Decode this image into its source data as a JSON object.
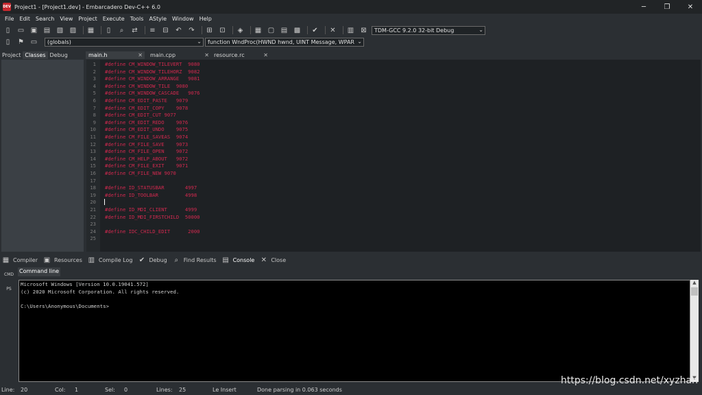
{
  "window": {
    "logo_text": "DEV",
    "title": "Project1 - [Project1.dev] - Embarcadero Dev-C++ 6.0",
    "minimize": "─",
    "restore": "❐",
    "close": "✕"
  },
  "menu": [
    "File",
    "Edit",
    "Search",
    "View",
    "Project",
    "Execute",
    "Tools",
    "AStyle",
    "Window",
    "Help"
  ],
  "toolbar": {
    "compiler_select": "TDM-GCC 9.2.0 32-bit Debug",
    "scope_select": "(globals)",
    "function_select": "function WndProc(HWND hwnd, UINT Message, WPAR"
  },
  "left_tabs": [
    "Project",
    "Classes",
    "Debug"
  ],
  "left_active": "Classes",
  "editor_tabs": [
    {
      "label": "main.h",
      "active": true
    },
    {
      "label": "main.cpp",
      "active": false
    },
    {
      "label": "resource.rc",
      "active": false
    }
  ],
  "code_lines": [
    "#define CM_WINDOW_TILEVERT  9080",
    "#define CM_WINDOW_TILEHORZ  9082",
    "#define CM_WINDOW_ARRANGE   9081",
    "#define CM_WINDOW_TILE  9080",
    "#define CM_WINDOW_CASCADE   9076",
    "#define CM_EDIT_PASTE   9079",
    "#define CM_EDIT_COPY    9078",
    "#define CM_EDIT_CUT 9077",
    "#define CM_EDIT_REDO    9076",
    "#define CM_EDIT_UNDO    9075",
    "#define CM_FILE_SAVEAS  9074",
    "#define CM_FILE_SAVE    9073",
    "#define CM_FILE_OPEN    9072",
    "#define CM_HELP_ABOUT   9072",
    "#define CM_FILE_EXIT    9071",
    "#define CM_FILE_NEW 9070",
    "",
    "#define ID_STATUSBAR       4997",
    "#define ID_TOOLBAR         4998",
    "",
    "#define ID_MDI_CLIENT      4999",
    "#define ID_MDI_FIRSTCHILD  50000",
    "",
    "#define IDC_CHILD_EDIT      2000",
    ""
  ],
  "bottom_tabs": [
    {
      "label": "Compiler",
      "icon": "grid-icon"
    },
    {
      "label": "Resources",
      "icon": "resources-icon"
    },
    {
      "label": "Compile Log",
      "icon": "chart-icon"
    },
    {
      "label": "Debug",
      "icon": "check-icon"
    },
    {
      "label": "Find Results",
      "icon": "find-icon"
    },
    {
      "label": "Console",
      "icon": "console-icon",
      "active": true
    },
    {
      "label": "Close",
      "icon": "close-icon"
    }
  ],
  "console": {
    "side_cmd": "CMD",
    "side_ps": "PS",
    "tab": "Command line",
    "lines": [
      "Microsoft Windows [Version 10.0.19041.572]",
      "(c) 2020 Microsoft Corporation. All rights reserved.",
      "",
      "C:\\Users\\Anonymous\\Documents>"
    ]
  },
  "status": {
    "line_label": "Line:",
    "line_value": "20",
    "col_label": "Col:",
    "col_value": "1",
    "sel_label": "Sel:",
    "sel_value": "0",
    "lines_label": "Lines:",
    "lines_value": "25",
    "mode": "Le Insert",
    "message": "Done parsing in 0.063 seconds"
  },
  "watermark": "https://blog.csdn.net/xyzhan"
}
